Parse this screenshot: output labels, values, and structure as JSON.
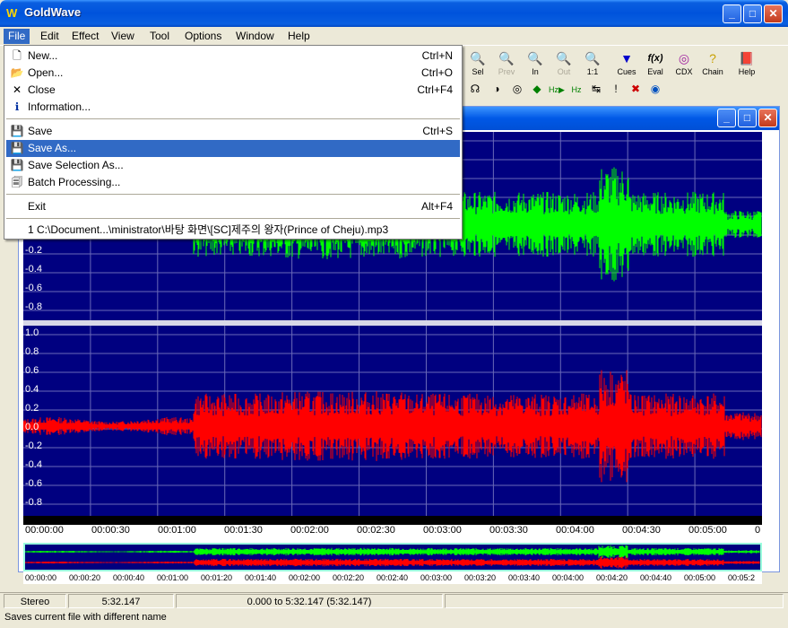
{
  "window": {
    "title": "GoldWave",
    "icon_letter": "W"
  },
  "menubar": [
    "File",
    "Edit",
    "Effect",
    "View",
    "Tool",
    "Options",
    "Window",
    "Help"
  ],
  "toolbar": {
    "row1": [
      {
        "label": "Sel",
        "icon": "search-icon",
        "disabled": false
      },
      {
        "label": "Prev",
        "icon": "zoom-prev-icon",
        "disabled": true
      },
      {
        "label": "In",
        "icon": "zoom-in-icon",
        "disabled": false
      },
      {
        "label": "Out",
        "icon": "zoom-out-icon",
        "disabled": true
      },
      {
        "label": "1:1",
        "icon": "zoom-full-icon",
        "disabled": false
      },
      {
        "label": "Cues",
        "icon": "cues-icon",
        "disabled": false
      },
      {
        "label": "Eval",
        "icon": "eval-icon",
        "disabled": false
      },
      {
        "label": "CDX",
        "icon": "cd-icon",
        "disabled": false
      },
      {
        "label": "Chain",
        "icon": "chain-icon",
        "disabled": false
      },
      {
        "label": "Help",
        "icon": "help-book-icon",
        "disabled": false
      }
    ]
  },
  "file_menu": {
    "items": [
      {
        "label": "New...",
        "shortcut": "Ctrl+N",
        "icon": "new-file-icon"
      },
      {
        "label": "Open...",
        "shortcut": "Ctrl+O",
        "icon": "open-folder-icon"
      },
      {
        "label": "Close",
        "shortcut": "Ctrl+F4",
        "icon": "close-x-icon"
      },
      {
        "label": "Information...",
        "shortcut": "",
        "icon": "info-icon"
      },
      {
        "label": "Save",
        "shortcut": "Ctrl+S",
        "icon": "save-disk-icon"
      },
      {
        "label": "Save As...",
        "shortcut": "",
        "icon": "save-as-disk-icon"
      },
      {
        "label": "Save Selection As...",
        "shortcut": "",
        "icon": "save-selection-icon"
      },
      {
        "label": "Batch Processing...",
        "shortcut": "",
        "icon": "batch-icon"
      },
      {
        "label": "Exit",
        "shortcut": "Alt+F4",
        "icon": ""
      },
      {
        "label": "1 C:\\Document...\\ministrator\\바탕 화면\\[SC]제주의 왕자(Prince of Cheju).mp3",
        "shortcut": "",
        "icon": ""
      }
    ],
    "highlighted": "Save As..."
  },
  "channels": {
    "top_labels": [
      "-0.2",
      "-0.4",
      "-0.6",
      "-0.8"
    ],
    "bottom_labels": [
      "1.0",
      "0.8",
      "0.6",
      "0.4",
      "0.2",
      "0.0",
      "-0.2",
      "-0.4",
      "-0.6",
      "-0.8"
    ],
    "top_color": "#00ff00",
    "bottom_color": "#ff0000"
  },
  "timeline": [
    "00:00:00",
    "00:00:30",
    "00:01:00",
    "00:01:30",
    "00:02:00",
    "00:02:30",
    "00:03:00",
    "00:03:30",
    "00:04:00",
    "00:04:30",
    "00:05:00",
    "0"
  ],
  "overview_timeline": [
    "00:00:00",
    "00:00:20",
    "00:00:40",
    "00:01:00",
    "00:01:20",
    "00:01:40",
    "00:02:00",
    "00:02:20",
    "00:02:40",
    "00:03:00",
    "00:03:20",
    "00:03:40",
    "00:04:00",
    "00:04:20",
    "00:04:40",
    "00:05:00",
    "00:05:2"
  ],
  "status": {
    "channels": "Stereo",
    "length": "5:32.147",
    "selection": "0.000 to 5:32.147 (5:32.147)",
    "hint": "Saves current file with different name"
  }
}
